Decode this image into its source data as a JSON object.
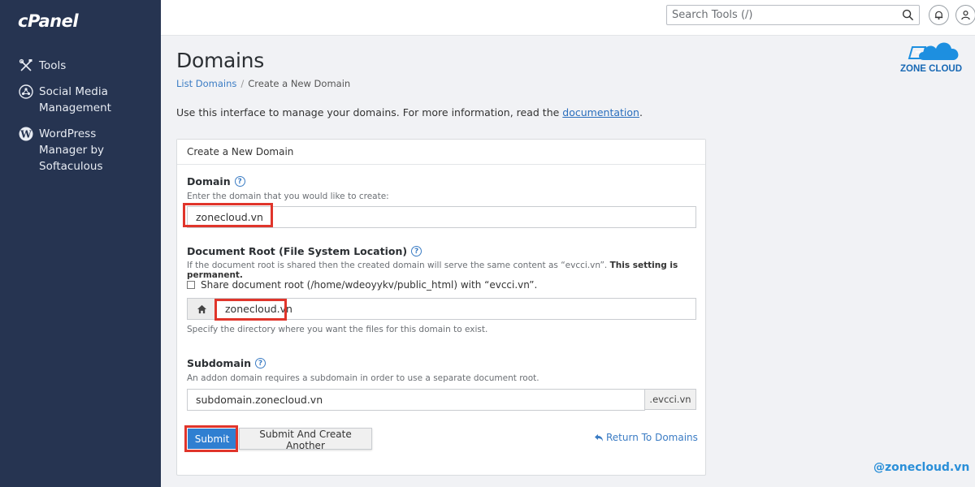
{
  "sidebar": {
    "logo": "cPanel",
    "items": [
      {
        "label": "Tools",
        "icon": "tools-icon"
      },
      {
        "label": "Social Media\nManagement",
        "icon": "social-media-icon"
      },
      {
        "label": "WordPress\n Manager by\nSoftaculous",
        "icon": "wordpress-icon"
      }
    ]
  },
  "topbar": {
    "search_placeholder": "Search Tools (/)"
  },
  "page": {
    "title": "Domains",
    "breadcrumb": {
      "link": "List Domains",
      "separator": "/",
      "current": "Create a New Domain"
    },
    "intro_text": "Use this interface to manage your domains. For more information, read the ",
    "intro_link": "documentation",
    "intro_end": "."
  },
  "form": {
    "panel_title": "Create a New Domain",
    "domain": {
      "label": "Domain",
      "description": "Enter the domain that you would like to create:",
      "value": "zonecloud.vn"
    },
    "docroot": {
      "label": "Document Root (File System Location)",
      "description": "If the document root is shared then the created domain will serve the same content as “evcci.vn”.",
      "description_bold": "This setting is permanent.",
      "checkbox_label": "Share document root (/home/wdeoyykv/public_html) with “evcci.vn”.",
      "value": "zonecloud.vn",
      "help": "Specify the directory where you want the files for this domain to exist."
    },
    "subdomain": {
      "label": "Subdomain",
      "description": "An addon domain requires a subdomain in order to use a separate document root.",
      "value": "subdomain.zonecloud.vn",
      "suffix": ".evcci.vn"
    },
    "buttons": {
      "submit": "Submit",
      "submit_another": "Submit And Create Another",
      "return": "Return To Domains"
    }
  },
  "branding": {
    "logo_text": "ZONE CLOUD",
    "watermark": "@zonecloud.vn"
  },
  "colors": {
    "sidebar": "#263451",
    "accent": "#2f7fd1",
    "highlight": "#e0352b",
    "link": "#3b7cc4"
  }
}
